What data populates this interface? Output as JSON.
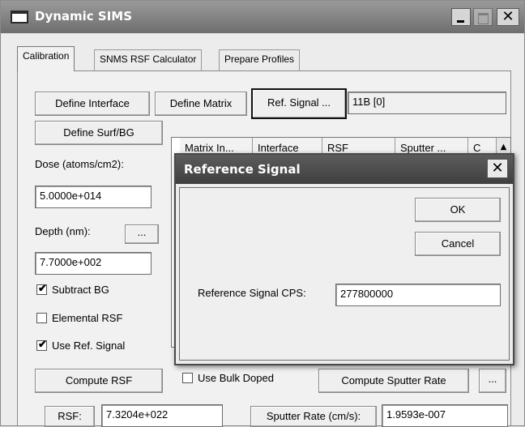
{
  "window": {
    "title": "Dynamic SIMS",
    "close_glyph": "✕"
  },
  "tabs": [
    "Calibration",
    "SNMS RSF Calculator",
    "Prepare Profiles"
  ],
  "buttons": {
    "define_interface": "Define Interface",
    "define_matrix": "Define Matrix",
    "ref_signal": "Ref. Signal ...",
    "define_surf_bg": "Define Surf/BG",
    "depth_more": "...",
    "compute_rsf": "Compute RSF",
    "compute_sputter_rate": "Compute Sputter Rate",
    "sputter_more": "..."
  },
  "ref_signal_value": "11B [0]",
  "dose": {
    "label": "Dose (atoms/cm2):",
    "value": "5.0000e+014"
  },
  "depth": {
    "label": "Depth (nm):",
    "value": "7.7000e+002"
  },
  "checks": {
    "subtract_bg": {
      "label": "Subtract BG",
      "checked": true
    },
    "elemental_rsf": {
      "label": "Elemental RSF",
      "checked": false
    },
    "use_ref_signal": {
      "label": "Use Ref. Signal",
      "checked": true
    },
    "use_bulk_doped": {
      "label": "Use Bulk Doped",
      "checked": false
    }
  },
  "table_columns": [
    "Matrix In...",
    "Interface",
    "RSF",
    "Sputter ...",
    "C"
  ],
  "rsf": {
    "label": "RSF:",
    "value": "7.3204e+022"
  },
  "sputter_rate": {
    "label": "Sputter Rate (cm/s):",
    "value": "1.9593e-007"
  },
  "dialog": {
    "title": "Reference Signal",
    "close_glyph": "✕",
    "ok": "OK",
    "cancel": "Cancel",
    "cps_label": "Reference Signal CPS:",
    "cps_value": "277800000"
  }
}
